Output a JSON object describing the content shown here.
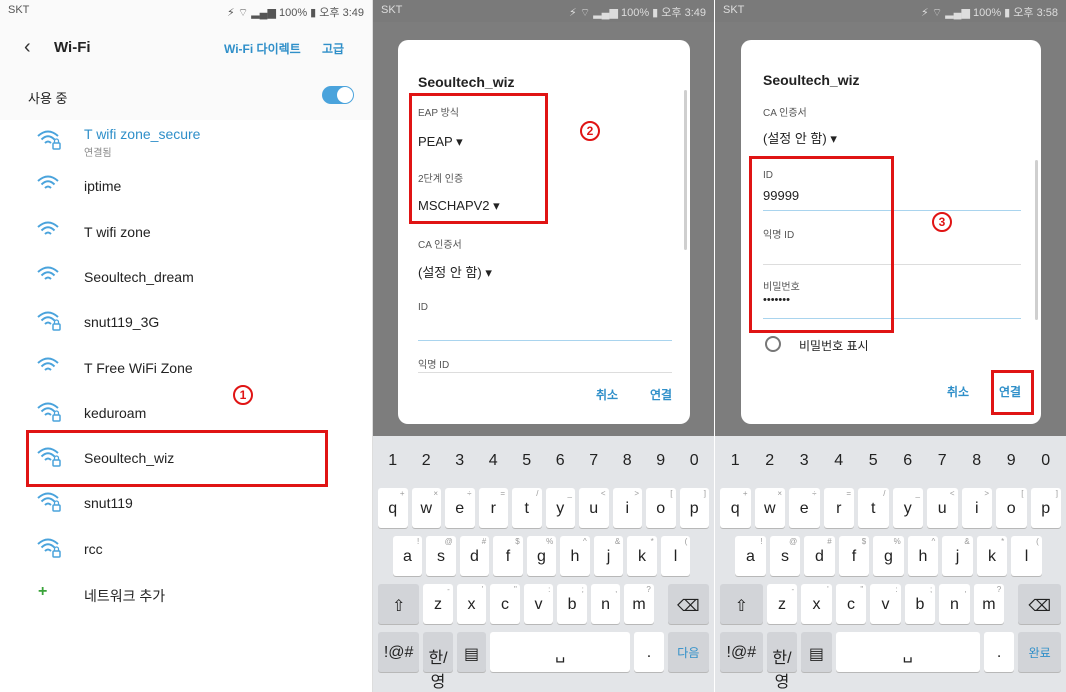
{
  "panel1": {
    "status": {
      "carrier": "SKT",
      "right": "¥\u0000 ⌔ .ıl 100% ▮ 오후 3:49"
    },
    "title": "Wi-Fi",
    "wifi_direct": "Wi-Fi 다이렉트",
    "advanced": "고급",
    "in_use": "사용 중",
    "networks": [
      {
        "name": "T wifi zone_secure",
        "sub": "연결됨",
        "secure": true,
        "active": true
      },
      {
        "name": "iptime",
        "secure": false
      },
      {
        "name": "T wifi zone",
        "secure": false
      },
      {
        "name": "Seoultech_dream",
        "secure": false
      },
      {
        "name": "snut119_3G",
        "secure": true
      },
      {
        "name": "T Free WiFi Zone",
        "secure": false
      },
      {
        "name": "keduroam",
        "secure": true
      },
      {
        "name": "Seoultech_wiz",
        "secure": true
      },
      {
        "name": "snut119",
        "secure": true
      },
      {
        "name": "rcc",
        "secure": true
      }
    ],
    "add_network": "네트워크 추가",
    "step": "1"
  },
  "panel2": {
    "status": {
      "carrier": "SKT",
      "right": "¥ ⌔ .ıl 100% ▮ 오후 3:49"
    },
    "dialog_title": "Seoultech_wiz",
    "eap_label": "EAP 방식",
    "eap_value": "PEAP",
    "phase2_label": "2단계 인증",
    "phase2_value": "MSCHAPV2",
    "ca_label": "CA 인증서",
    "ca_value": "(설정 안 함)",
    "id_label": "ID",
    "anon_label": "익명 ID",
    "cancel": "취소",
    "connect": "연결",
    "step": "2"
  },
  "panel3": {
    "status": {
      "carrier": "SKT",
      "right": "¥ ⌔ .ıl 100% ▮ 오후 3:58"
    },
    "dialog_title": "Seoultech_wiz",
    "ca_label": "CA 인증서",
    "ca_value": "(설정 안 함)",
    "id_label": "ID",
    "id_value": "99999",
    "anon_label": "익명 ID",
    "pw_label": "비밀번호",
    "pw_value": "•••••••",
    "show_pw": "비밀번호 표시",
    "cancel": "취소",
    "connect": "연결",
    "step": "3"
  },
  "keyboard": {
    "numbers": [
      "1",
      "2",
      "3",
      "4",
      "5",
      "6",
      "7",
      "8",
      "9",
      "0"
    ],
    "row1": [
      "q",
      "w",
      "e",
      "r",
      "t",
      "y",
      "u",
      "i",
      "o",
      "p"
    ],
    "row1_hints": [
      "+",
      "×",
      "÷",
      "=",
      "/",
      "_",
      "<",
      ">",
      "[",
      "]"
    ],
    "row2": [
      "a",
      "s",
      "d",
      "f",
      "g",
      "h",
      "j",
      "k",
      "l"
    ],
    "row2_hints": [
      "!",
      "@",
      "#",
      "$",
      "%",
      "^",
      "&",
      "*",
      "("
    ],
    "row3": [
      "z",
      "x",
      "c",
      "v",
      "b",
      "n",
      "m"
    ],
    "row3_hints": [
      "-",
      "'",
      "\"",
      ":",
      ";",
      ",",
      "?"
    ],
    "shift": "⇧",
    "backspace": "⌫",
    "symbols": "!@#",
    "lang": "한/영",
    "clip": "▤",
    "period": ".",
    "next_p2": "다음",
    "done_p3": "완료"
  },
  "colors": {
    "accent": "#2f8fc9",
    "highlight": "#e01414",
    "toggle": "#4aa3dc"
  },
  "icons": {
    "back": "‹",
    "dropdown": "▼",
    "add": "+"
  }
}
